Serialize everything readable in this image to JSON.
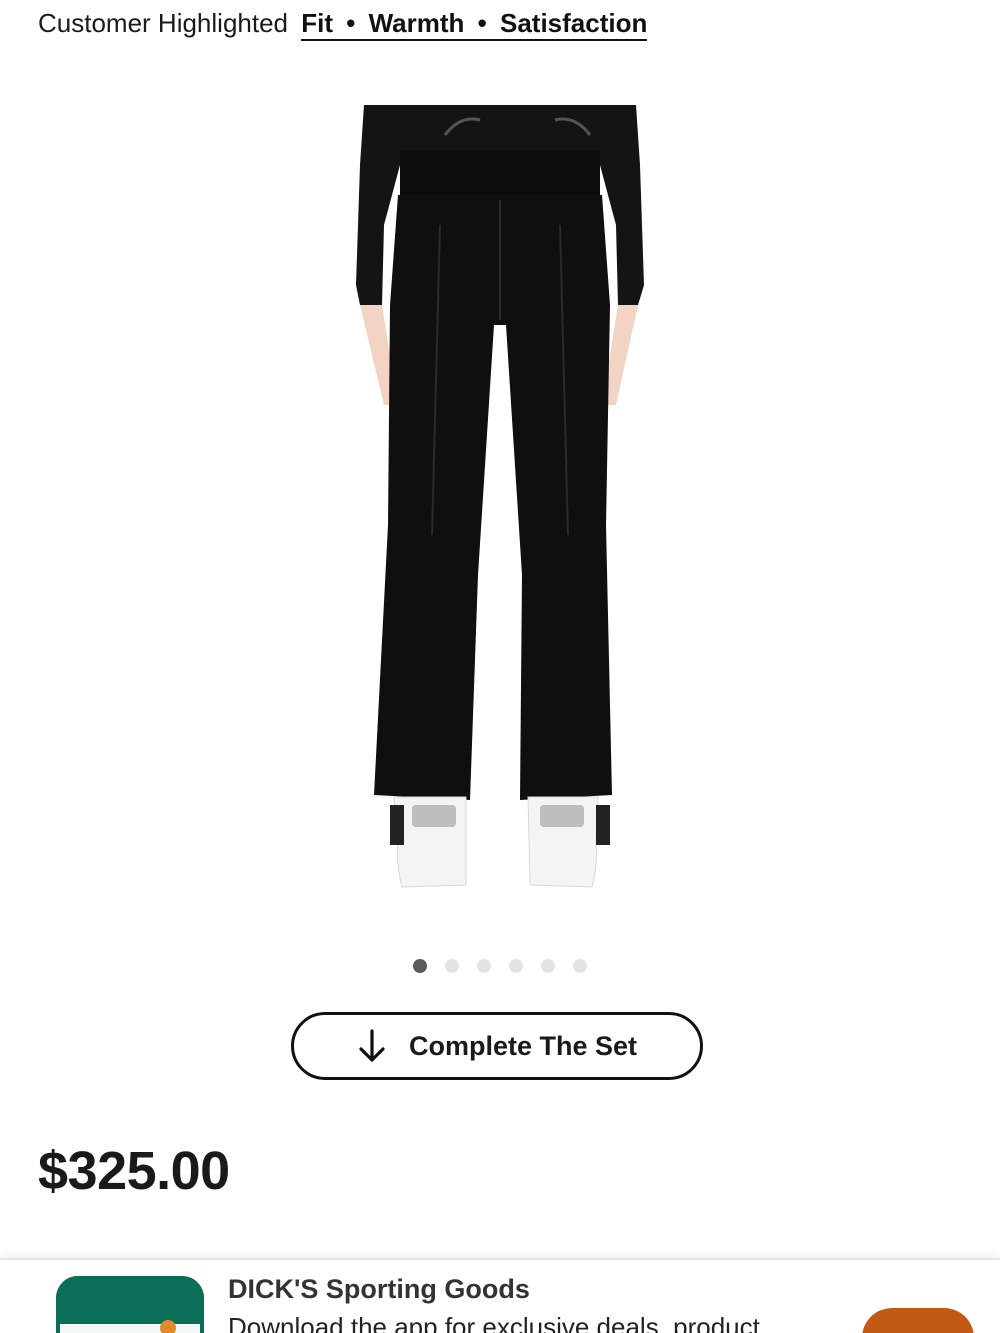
{
  "highlights": {
    "prefix": "Customer Highlighted",
    "tags": [
      "Fit",
      "Warmth",
      "Satisfaction"
    ],
    "separator": "•"
  },
  "product": {
    "image_icon": "ski-pants-product-photo",
    "carousel": {
      "total": 6,
      "active_index": 1
    }
  },
  "complete_set": {
    "label": "Complete The Set",
    "icon": "arrow-down-icon"
  },
  "price": "$325.00",
  "app_banner": {
    "title": "DICK'S Sporting Goods",
    "description": "Download the app for exclusive deals, product",
    "logo_icon": "dicks-app-logo",
    "brand_color": "#0b6f57",
    "cta_color": "#c25a15"
  }
}
